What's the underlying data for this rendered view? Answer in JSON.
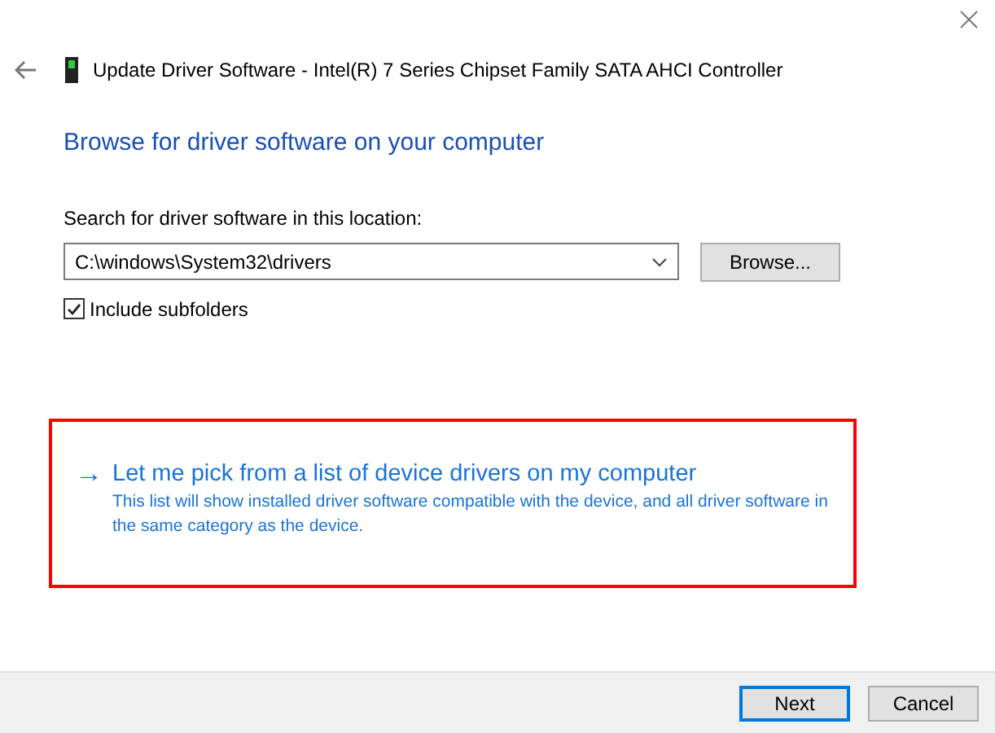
{
  "window": {
    "title": "Update Driver Software - Intel(R) 7 Series Chipset Family SATA AHCI Controller"
  },
  "heading": "Browse for driver software on your computer",
  "location": {
    "label": "Search for driver software in this location:",
    "value": "C:\\windows\\System32\\drivers",
    "browse_button": "Browse..."
  },
  "include_subfolders": {
    "label": "Include subfolders",
    "checked": true
  },
  "pick_option": {
    "arrow": "→",
    "title": "Let me pick from a list of device drivers on my computer",
    "description": "This list will show installed driver software compatible with the device, and all driver software in the same category as the device.",
    "highlighted": true
  },
  "buttons": [
    {
      "label": "Next",
      "kind": "default"
    },
    {
      "label": "Cancel",
      "kind": "normal"
    }
  ]
}
